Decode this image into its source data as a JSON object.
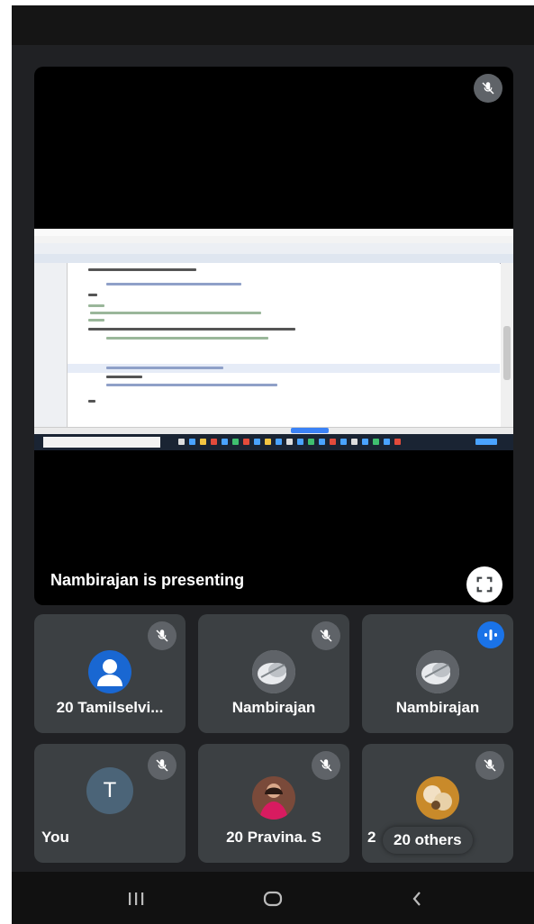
{
  "presentation": {
    "status_text": "Nambirajan is presenting"
  },
  "participants": [
    {
      "name": "20 Tamilselvi...",
      "avatar": "person-icon",
      "mic": "muted"
    },
    {
      "name": "Nambirajan",
      "avatar": "photo",
      "mic": "muted"
    },
    {
      "name": "Nambirajan",
      "avatar": "photo",
      "mic": "speaking"
    },
    {
      "name": "You",
      "avatar_letter": "T",
      "mic": "muted"
    },
    {
      "name": "20 Pravina. S",
      "avatar": "photo",
      "mic": "muted"
    },
    {
      "name": "2",
      "avatar": "photo",
      "mic": "muted"
    }
  ],
  "others_pill": {
    "label": "20 others"
  },
  "navigation": {
    "buttons": [
      "recent-apps-icon",
      "home-icon",
      "back-icon"
    ]
  },
  "colors": {
    "background": "#202124",
    "tile": "#3c4043",
    "accent": "#1a73e8"
  }
}
